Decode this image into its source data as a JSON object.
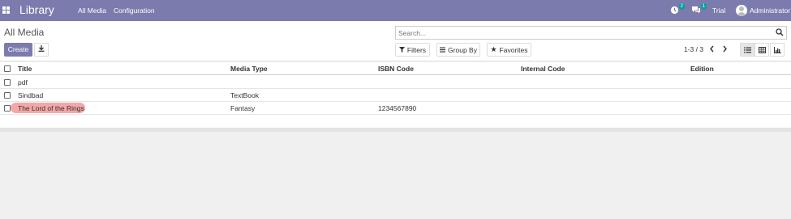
{
  "navbar": {
    "brand": "Library",
    "menu": [
      "All Media",
      "Configuration"
    ],
    "activity_count": "2",
    "message_count": "1",
    "trial_label": "Trial",
    "user_name": "Administrator"
  },
  "control_panel": {
    "title": "All Media",
    "search_placeholder": "Search...",
    "create_label": "Create",
    "filters_label": "Filters",
    "groupby_label": "Group By",
    "favorites_label": "Favorites",
    "pager": "1-3 / 3"
  },
  "list": {
    "columns": [
      "Title",
      "Media Type",
      "ISBN Code",
      "Internal Code",
      "Edition"
    ],
    "rows": [
      {
        "title": "pdf",
        "media_type": "",
        "isbn": "",
        "internal": "",
        "edition": ""
      },
      {
        "title": "Sindbad",
        "media_type": "TextBook",
        "isbn": "",
        "internal": "",
        "edition": ""
      },
      {
        "title": "The Lord of the Rings",
        "media_type": "Fantasy",
        "isbn": "1234567890",
        "internal": "",
        "edition": ""
      }
    ]
  },
  "colors": {
    "navbar": "#7c7bad",
    "highlight": "#f4a7a7",
    "badge": "#00a09d"
  }
}
